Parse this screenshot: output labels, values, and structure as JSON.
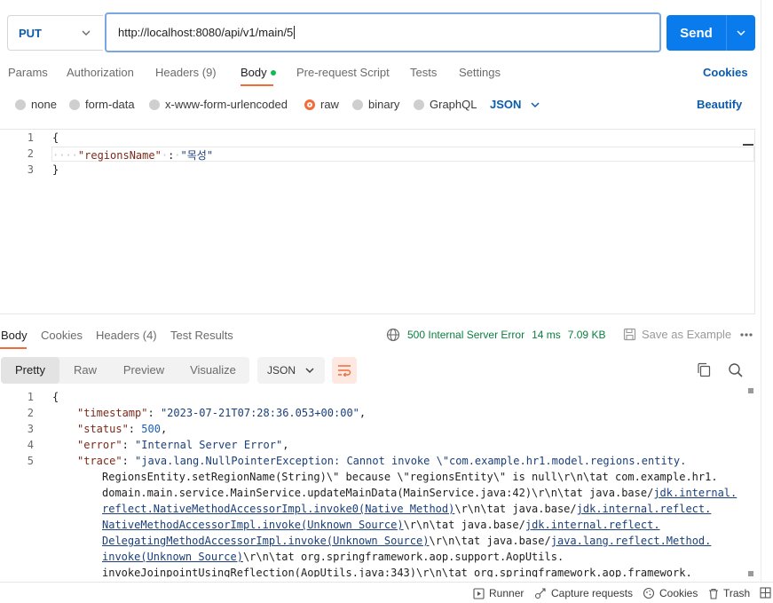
{
  "request": {
    "method": "PUT",
    "url": "http://localhost:8080/api/v1/main/5",
    "send_label": "Send"
  },
  "request_tabs": [
    {
      "label": "Params"
    },
    {
      "label": "Authorization"
    },
    {
      "label": "Headers (9)"
    },
    {
      "label": "Body"
    },
    {
      "label": "Pre-request Script"
    },
    {
      "label": "Tests"
    },
    {
      "label": "Settings"
    }
  ],
  "cookies_label": "Cookies",
  "body_types": [
    {
      "label": "none"
    },
    {
      "label": "form-data"
    },
    {
      "label": "x-www-form-urlencoded"
    },
    {
      "label": "raw"
    },
    {
      "label": "binary"
    },
    {
      "label": "GraphQL"
    }
  ],
  "body_format": "JSON",
  "beautify_label": "Beautify",
  "request_body": {
    "line_numbers": [
      "1",
      "2",
      "3"
    ],
    "open_brace": "{",
    "key": "\"regionsName\"",
    "colon": ":",
    "value": "\"목성\"",
    "close_brace": "}"
  },
  "response_tabs": [
    {
      "label": "Body"
    },
    {
      "label": "Cookies"
    },
    {
      "label": "Headers (4)"
    },
    {
      "label": "Test Results"
    }
  ],
  "response_status": {
    "status": "500 Internal Server Error",
    "time": "14 ms",
    "size": "7.09 KB",
    "save_example": "Save as Example"
  },
  "response_views": [
    {
      "label": "Pretty"
    },
    {
      "label": "Raw"
    },
    {
      "label": "Preview"
    },
    {
      "label": "Visualize"
    }
  ],
  "response_format": "JSON",
  "response_body": {
    "line_numbers": [
      "1",
      "2",
      "3",
      "4",
      "5"
    ],
    "open_brace": "{",
    "timestamp_key": "\"timestamp\"",
    "timestamp_val": "\"2023-07-21T07:28:36.053+00:00\"",
    "status_key": "\"status\"",
    "status_val": "500",
    "error_key": "\"error\"",
    "error_val": "\"Internal Server Error\"",
    "trace_key": "\"trace\"",
    "trace_l1": "\"java.lang.NullPointerException: Cannot invoke \\\"com.example.hr1.model.regions.entity.",
    "trace_l2": "RegionsEntity.setRegionName(String)\\\" because \\\"regionsEntity\\\" is null\\r\\n\\tat com.example.hr1.",
    "trace_l3a": "domain.main.service.MainService.updateMainData(MainService.java:42)\\r\\n\\tat java.base/",
    "trace_l3b": "jdk.internal.",
    "trace_l4a": "reflect.NativeMethodAccessorImpl.invoke0(Native Method)",
    "trace_l4b": "\\r\\n\\tat java.base/",
    "trace_l4c": "jdk.internal.reflect.",
    "trace_l5a": "NativeMethodAccessorImpl.invoke(Unknown Source)",
    "trace_l5b": "\\r\\n\\tat java.base/",
    "trace_l5c": "jdk.internal.reflect.",
    "trace_l6a": "DelegatingMethodAccessorImpl.invoke(Unknown Source)",
    "trace_l6b": "\\r\\n\\tat java.base/",
    "trace_l6c": "java.lang.reflect.Method.",
    "trace_l7a": "invoke(Unknown Source)",
    "trace_l7b": "\\r\\n\\tat org.springframework.aop.support.AopUtils.",
    "trace_l8": "invokeJoinpointUsingReflection(AopUtils.java:343)\\r\\n\\tat org.springframework.aop.framework."
  },
  "statusbar": {
    "runner": "Runner",
    "capture": "Capture requests",
    "cookies": "Cookies",
    "trash": "Trash"
  },
  "colors": {
    "accent": "#f26b3a",
    "primary": "#097bed",
    "link": "#0b5cad",
    "success": "#0a7f3f"
  }
}
